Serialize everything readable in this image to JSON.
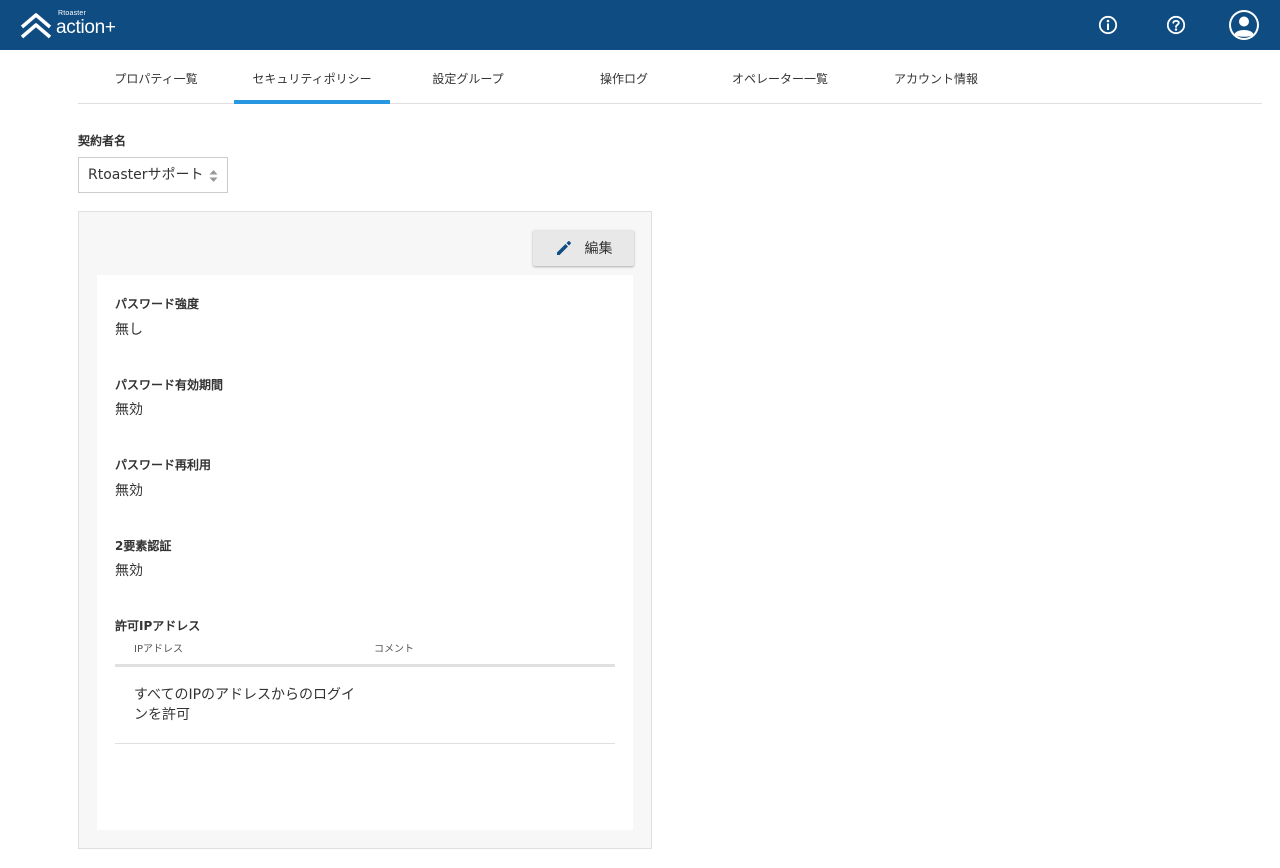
{
  "app": {
    "brand_small": "Rtoaster",
    "brand_main": "action+"
  },
  "header_icons": [
    "info-icon",
    "help-icon",
    "user-avatar-icon"
  ],
  "tabs": [
    {
      "label": "プロパティ一覧",
      "active": false
    },
    {
      "label": "セキュリティポリシー",
      "active": true
    },
    {
      "label": "設定グループ",
      "active": false
    },
    {
      "label": "操作ログ",
      "active": false
    },
    {
      "label": "オペレーター一覧",
      "active": false
    },
    {
      "label": "アカウント情報",
      "active": false
    }
  ],
  "contract": {
    "label": "契約者名",
    "selected": "Rtoasterサポート"
  },
  "panel": {
    "edit_label": "編集",
    "fields": [
      {
        "label": "パスワード強度",
        "value": "無し"
      },
      {
        "label": "パスワード有効期間",
        "value": "無効"
      },
      {
        "label": "パスワード再利用",
        "value": "無効"
      },
      {
        "label": "2要素認証",
        "value": "無効"
      }
    ],
    "ip": {
      "label": "許可IPアドレス",
      "columns": [
        "IPアドレス",
        "コメント"
      ],
      "rows": [
        {
          "ip": "すべてのIPのアドレスからのログインを許可",
          "comment": ""
        }
      ]
    }
  },
  "colors": {
    "header_bg": "#0f4c81",
    "tab_active": "#2896e0",
    "edit_icon": "#0f4c81"
  }
}
